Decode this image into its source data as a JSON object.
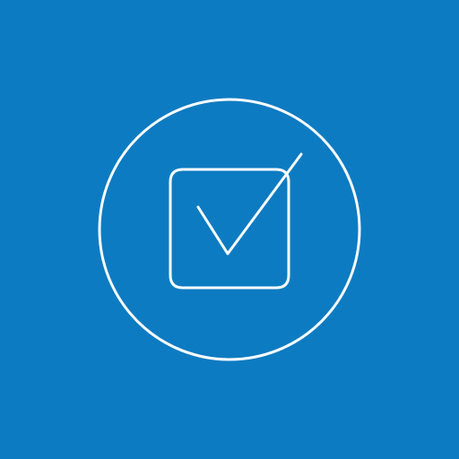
{
  "icon": {
    "name": "checkbox-checked-icon",
    "background_color": "#0d7bc2",
    "stroke_color": "#ffffff",
    "state": "checked"
  }
}
